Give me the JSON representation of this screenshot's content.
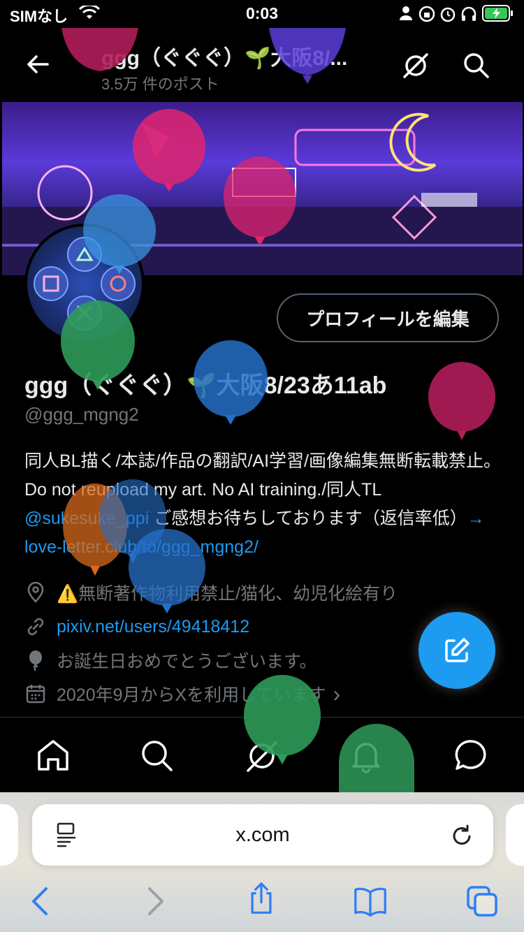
{
  "status_bar": {
    "carrier": "SIMなし",
    "time": "0:03"
  },
  "nav": {
    "title": "ggg（ぐぐぐ）🌱大阪8/...",
    "subtitle": "3.5万 件のポスト"
  },
  "profile": {
    "edit_button": "プロフィールを編集",
    "name": "ggg（ぐぐぐ）🌱大阪8/23あ11ab",
    "handle": "@ggg_mgng2",
    "bio_text_1": "同人BL描く/本誌/作品の翻訳/AI学習/画像編集無断転載禁止。Do not reupload my art. No AI training./同人TL ",
    "bio_mention": "@sukesuke_ppi",
    "bio_text_2": " ご感想お待ちしております（返信率低）",
    "bio_link": "→ love-letter.club/to/ggg_mgng2/",
    "location": "⚠️無断著作物利用禁止/猫化、幼児化絵有り",
    "website": "pixiv.net/users/49418412",
    "birthday": "お誕生日おめでとうございます。",
    "joined": "2020年9月からXを利用しています",
    "joined_chevron": "›"
  },
  "bottom_tabs": [
    "home-icon",
    "search-icon",
    "grok-icon",
    "notifications-icon",
    "messages-icon"
  ],
  "safari": {
    "address": "x.com"
  },
  "colors": {
    "accent": "#1d9bf0",
    "secondary_text": "#71767b",
    "background": "#000000"
  }
}
